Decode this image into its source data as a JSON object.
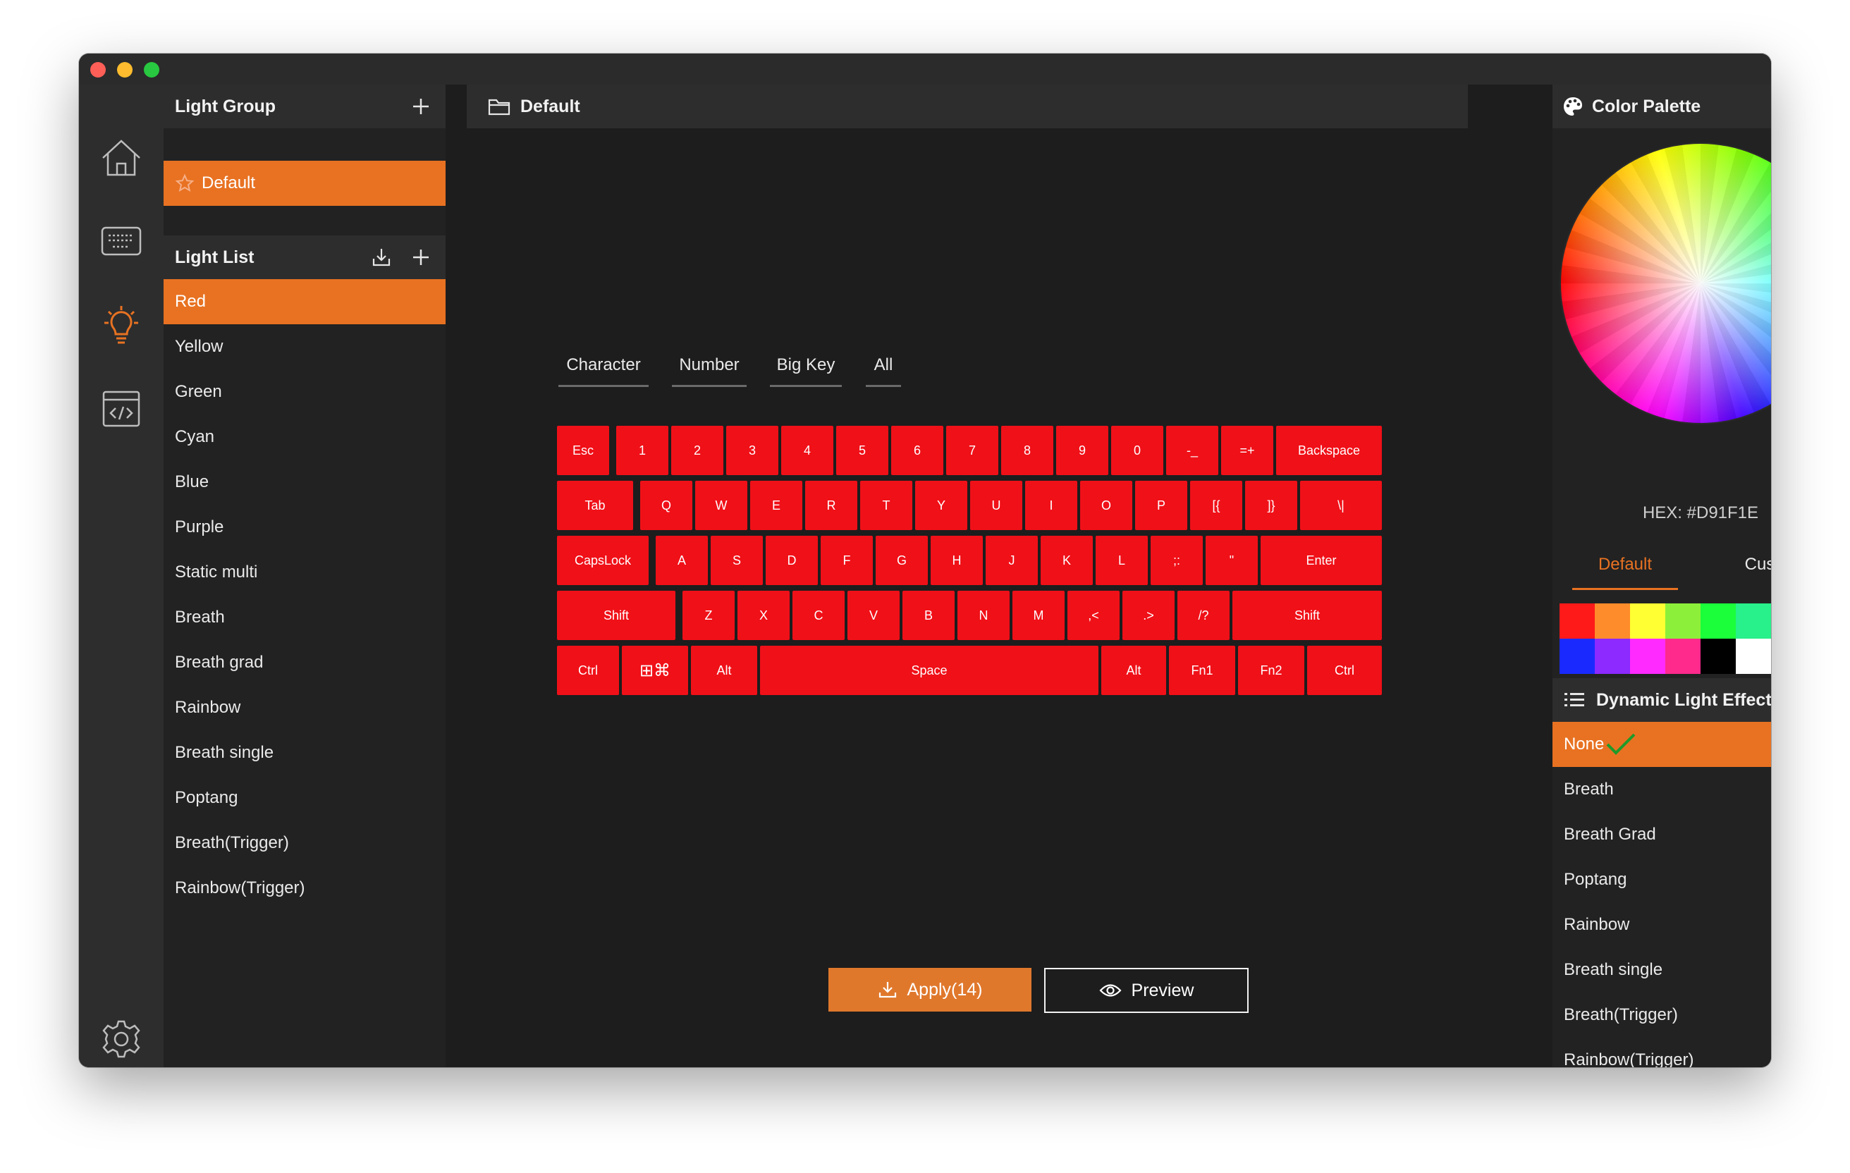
{
  "window": {
    "traffic_lights": [
      "close",
      "minimize",
      "zoom"
    ]
  },
  "rail": {
    "items": [
      {
        "name": "home-icon"
      },
      {
        "name": "keyboard-icon"
      },
      {
        "name": "lightbulb-icon",
        "active": true,
        "color": "#e87222"
      },
      {
        "name": "code-window-icon"
      },
      {
        "name": "gear-icon"
      }
    ]
  },
  "light_group": {
    "title": "Light Group",
    "add_icon": "plus-icon",
    "items": [
      {
        "label": "Default",
        "icon": "star-icon",
        "selected": true
      }
    ]
  },
  "light_list": {
    "title": "Light List",
    "import_icon": "import-icon",
    "add_icon": "plus-icon",
    "items": [
      {
        "label": "Red",
        "selected": true
      },
      {
        "label": "Yellow"
      },
      {
        "label": "Green"
      },
      {
        "label": "Cyan"
      },
      {
        "label": "Blue"
      },
      {
        "label": "Purple"
      },
      {
        "label": "Static multi"
      },
      {
        "label": "Breath"
      },
      {
        "label": "Breath grad"
      },
      {
        "label": "Rainbow"
      },
      {
        "label": "Breath single"
      },
      {
        "label": "Poptang"
      },
      {
        "label": "Breath(Trigger)"
      },
      {
        "label": "Rainbow(Trigger)"
      }
    ]
  },
  "main": {
    "title": "Default",
    "title_icon": "folder-icon",
    "tabs": [
      "Character",
      "Number",
      "Big Key",
      "All"
    ],
    "key_color": "#f01018",
    "keyboard_rows": [
      [
        "Esc",
        "1",
        "2",
        "3",
        "4",
        "5",
        "6",
        "7",
        "8",
        "9",
        "0",
        "-_",
        "=+",
        "Backspace"
      ],
      [
        "Tab",
        "Q",
        "W",
        "E",
        "R",
        "T",
        "Y",
        "U",
        "I",
        "O",
        "P",
        "[{",
        "]}",
        "\\|"
      ],
      [
        "CapsLock",
        "A",
        "S",
        "D",
        "F",
        "G",
        "H",
        "J",
        "K",
        "L",
        ";:",
        "\"",
        "Enter"
      ],
      [
        "Shift",
        "Z",
        "X",
        "C",
        "V",
        "B",
        "N",
        "M",
        ",<",
        ".>",
        "/?",
        "Shift"
      ],
      [
        "Ctrl",
        "⊞⌘",
        "Alt",
        "Space",
        "Alt",
        "Fn1",
        "Fn2",
        "Ctrl"
      ]
    ],
    "apply_label": "Apply(14)",
    "apply_icon": "download-icon",
    "preview_label": "Preview",
    "preview_icon": "eye-icon",
    "accent": "#e0782c"
  },
  "color_palette": {
    "title": "Color Palette",
    "icon": "palette-icon",
    "hex_label": "HEX: #D91F1E",
    "tabs": [
      {
        "label": "Default",
        "active": true
      },
      {
        "label": "Custom"
      }
    ],
    "swatches": [
      "#ff1a1a",
      "#ff8c2a",
      "#ffff33",
      "#8cf03a",
      "#1aff3a",
      "#28f08a",
      "#2affff",
      "#2a8cff",
      "#1a2aff",
      "#8c2aff",
      "#ff2aff",
      "#ff2a8c",
      "#000000",
      "#ffffff",
      "#ff9a33",
      "#28b8b8"
    ]
  },
  "dynamic_effect": {
    "title": "Dynamic Light Effect",
    "icon": "list-icon",
    "items": [
      {
        "label": "None",
        "selected": true,
        "check_icon": "check-icon"
      },
      {
        "label": "Breath"
      },
      {
        "label": "Breath Grad"
      },
      {
        "label": "Poptang"
      },
      {
        "label": "Rainbow"
      },
      {
        "label": "Breath single"
      },
      {
        "label": "Breath(Trigger)"
      },
      {
        "label": "Rainbow(Trigger)"
      }
    ]
  }
}
